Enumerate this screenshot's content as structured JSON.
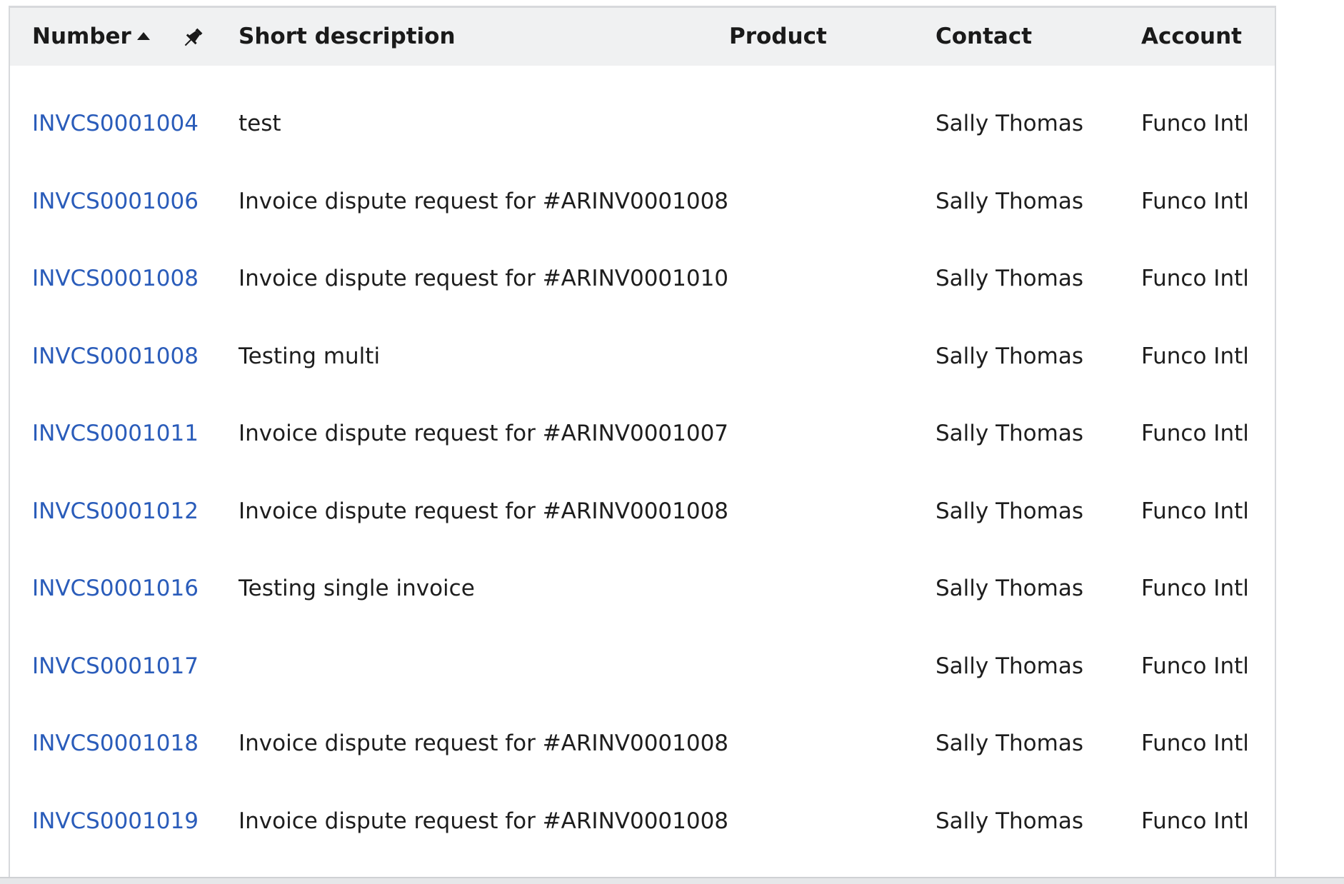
{
  "table": {
    "columns": {
      "number": "Number",
      "short_description": "Short description",
      "product": "Product",
      "contact": "Contact",
      "account": "Account"
    },
    "sort_icon": "sort-ascending-icon",
    "pin_icon": "pin-icon",
    "rows": [
      {
        "number": "INVCS0001004",
        "short_description": "test",
        "product": "",
        "contact": "Sally Thomas",
        "account": "Funco Intl"
      },
      {
        "number": "INVCS0001006",
        "short_description": "Invoice dispute request for #ARINV0001008",
        "product": "",
        "contact": "Sally Thomas",
        "account": "Funco Intl"
      },
      {
        "number": "INVCS0001008",
        "short_description": "Invoice dispute request for #ARINV0001010",
        "product": "",
        "contact": "Sally Thomas",
        "account": "Funco Intl"
      },
      {
        "number": "INVCS0001008",
        "short_description": "Testing multi",
        "product": "",
        "contact": "Sally Thomas",
        "account": "Funco Intl"
      },
      {
        "number": "INVCS0001011",
        "short_description": "Invoice dispute request for #ARINV0001007",
        "product": "",
        "contact": "Sally Thomas",
        "account": "Funco Intl"
      },
      {
        "number": "INVCS0001012",
        "short_description": "Invoice dispute request for #ARINV0001008",
        "product": "",
        "contact": "Sally Thomas",
        "account": "Funco Intl"
      },
      {
        "number": "INVCS0001016",
        "short_description": "Testing single invoice",
        "product": "",
        "contact": "Sally Thomas",
        "account": "Funco Intl"
      },
      {
        "number": "INVCS0001017",
        "short_description": "",
        "product": "",
        "contact": "Sally Thomas",
        "account": "Funco Intl"
      },
      {
        "number": "INVCS0001018",
        "short_description": "Invoice dispute request for #ARINV0001008",
        "product": "",
        "contact": "Sally Thomas",
        "account": "Funco Intl"
      },
      {
        "number": "INVCS0001019",
        "short_description": "Invoice dispute request for #ARINV0001008",
        "product": "",
        "contact": "Sally Thomas",
        "account": "Funco Intl"
      }
    ]
  },
  "colors": {
    "link": "#2a5cba",
    "header_bg": "#f0f1f2",
    "border": "#d7d9dc",
    "text": "#1d1d1d"
  }
}
